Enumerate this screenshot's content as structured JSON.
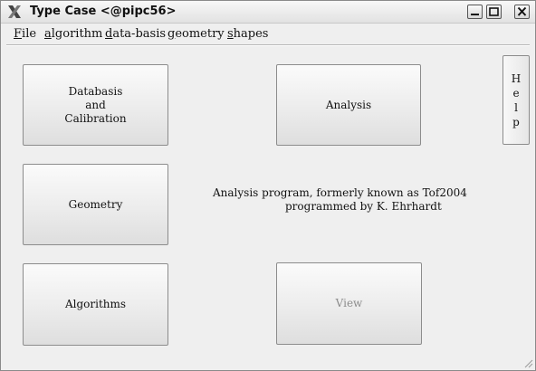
{
  "window": {
    "title": "Type Case <@pipc56>",
    "controls": {
      "minimize": "minimize-icon",
      "maximize": "maximize-icon",
      "close": "close-icon"
    }
  },
  "menu": [
    {
      "accel": "F",
      "rest": "ile"
    },
    {
      "accel": "a",
      "rest": "lgorithm"
    },
    {
      "accel": "d",
      "rest": "ata-basis"
    },
    {
      "accel": "g",
      "rest": "eometry"
    },
    {
      "accel": "s",
      "rest": "hapes"
    }
  ],
  "buttons": {
    "database": "Databasis\nand\nCalibration",
    "analysis": "Analysis",
    "geometry": "Geometry",
    "algorithms": "Algorithms",
    "view": "View"
  },
  "help": {
    "letters": [
      "H",
      "e",
      "l",
      "p"
    ]
  },
  "info": {
    "line1": "Analysis program, formerly known as Tof2004",
    "line2": "programmed by K. Ehrhardt"
  },
  "colors": {
    "window_bg": "#efefef",
    "disabled_text": "#8c8c8c",
    "border": "#8c8c8c"
  }
}
